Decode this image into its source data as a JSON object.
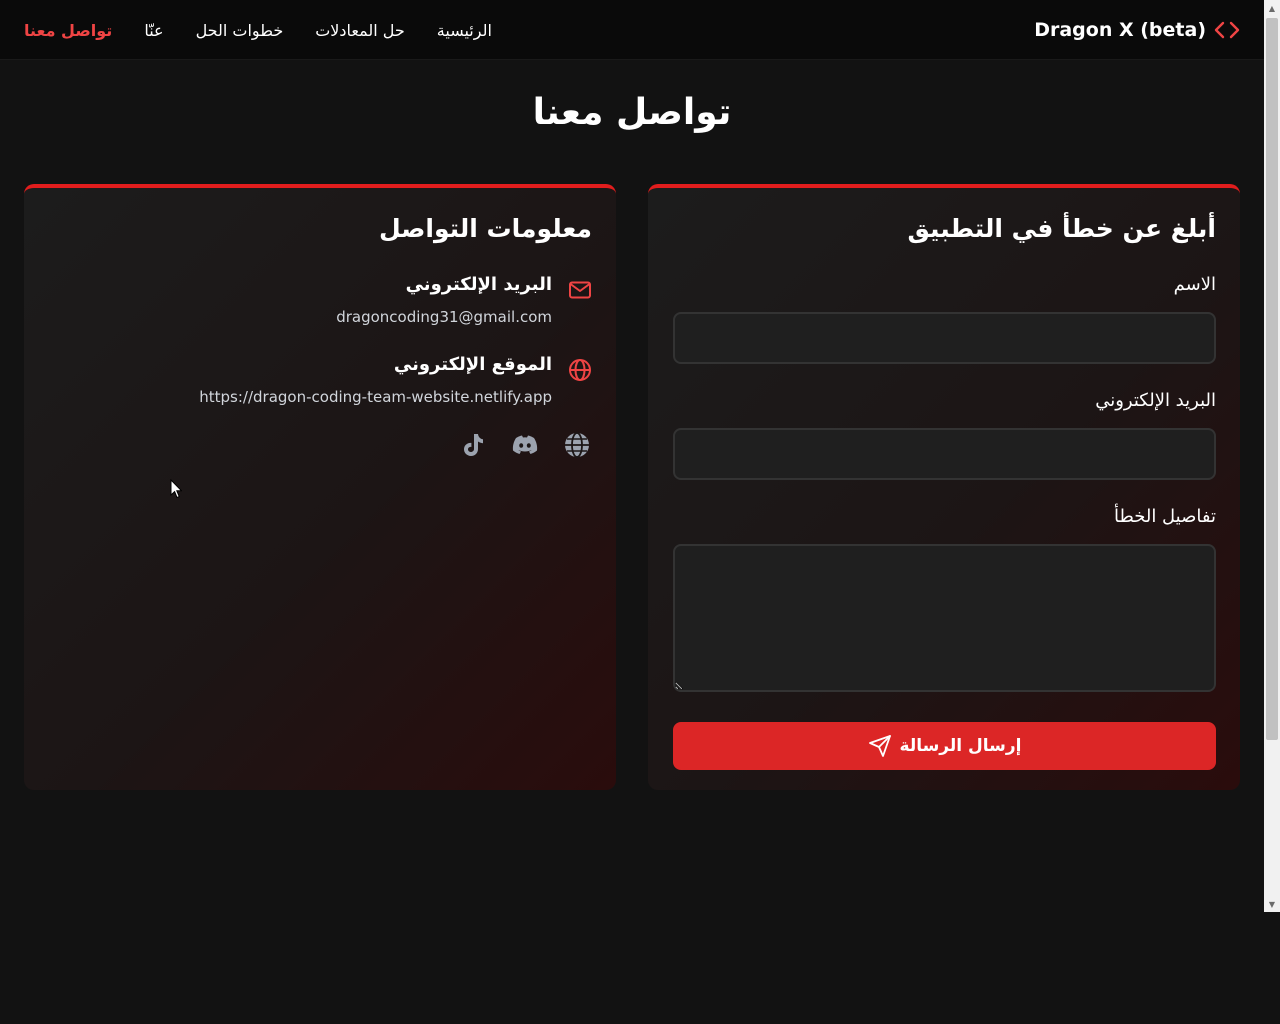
{
  "brand": {
    "name": "Dragon X (beta)",
    "icon": "code-brackets-icon",
    "accent": "#ef4444"
  },
  "nav": {
    "items": [
      {
        "label": "الرئيسية",
        "active": false
      },
      {
        "label": "حل المعادلات",
        "active": false
      },
      {
        "label": "خطوات الحل",
        "active": false
      },
      {
        "label": "عنّا",
        "active": false
      },
      {
        "label": "تواصل معنا",
        "active": true
      }
    ]
  },
  "page": {
    "title": "تواصل معنا"
  },
  "contact_info": {
    "title": "معلومات التواصل",
    "email": {
      "icon": "mail-icon",
      "label": "البريد الإلكتروني",
      "value": "dragoncoding31@gmail.com"
    },
    "website": {
      "icon": "globe-icon",
      "label": "الموقع الإلكتروني",
      "value": "https://dragon-coding-team-website.netlify.app"
    },
    "social": [
      "globe-icon",
      "discord-icon",
      "tiktok-icon"
    ]
  },
  "report_form": {
    "title": "أبلغ عن خطأ في التطبيق",
    "name_label": "الاسم",
    "name_value": "",
    "email_label": "البريد الإلكتروني",
    "email_value": "",
    "details_label": "تفاصيل الخطأ",
    "details_value": "",
    "submit_label": "إرسال الرسالة",
    "submit_icon": "send-icon"
  },
  "colors": {
    "background": "#121212",
    "navbar": "#0a0a0a",
    "primary": "#dc2626",
    "card_border": "#e11d1d"
  }
}
